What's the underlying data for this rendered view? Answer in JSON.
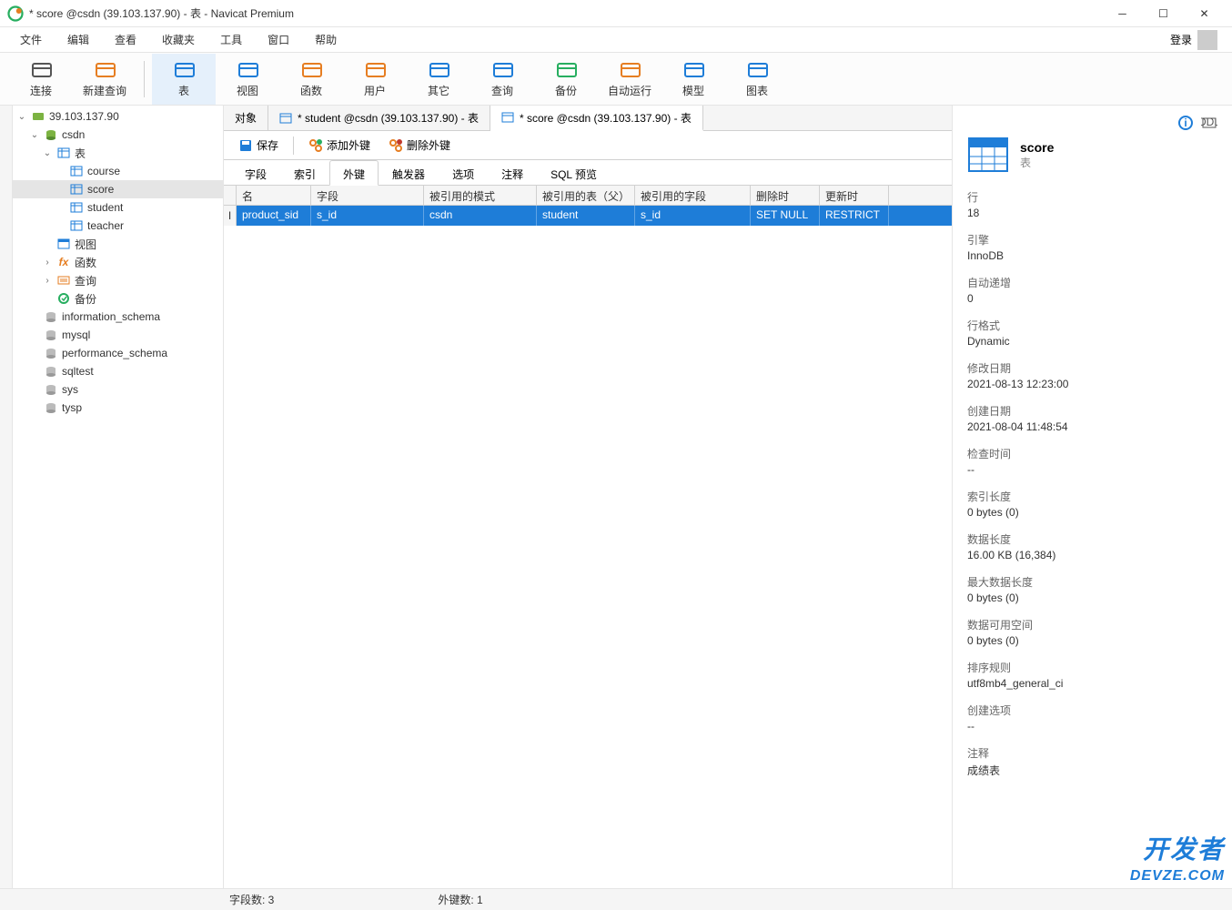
{
  "window": {
    "title": "* score @csdn (39.103.137.90) - 表 - Navicat Premium",
    "login": "登录"
  },
  "menubar": [
    "文件",
    "编辑",
    "查看",
    "收藏夹",
    "工具",
    "窗口",
    "帮助"
  ],
  "toolbar": [
    {
      "label": "连接",
      "color": "#555"
    },
    {
      "label": "新建查询",
      "color": "#e67e22"
    },
    {
      "label": "表",
      "color": "#1e7dd8",
      "active": true
    },
    {
      "label": "视图",
      "color": "#1e7dd8"
    },
    {
      "label": "函数",
      "color": "#e67e22"
    },
    {
      "label": "用户",
      "color": "#e67e22"
    },
    {
      "label": "其它",
      "color": "#1e7dd8"
    },
    {
      "label": "查询",
      "color": "#1e7dd8"
    },
    {
      "label": "备份",
      "color": "#27ae60"
    },
    {
      "label": "自动运行",
      "color": "#e67e22"
    },
    {
      "label": "模型",
      "color": "#1e7dd8"
    },
    {
      "label": "图表",
      "color": "#1e7dd8"
    }
  ],
  "tree": {
    "server": "39.103.137.90",
    "db_csdn": "csdn",
    "group_table": "表",
    "tables": [
      "course",
      "score",
      "student",
      "teacher"
    ],
    "view": "视图",
    "func": "函数",
    "query": "查询",
    "backup": "备份",
    "other_dbs": [
      "information_schema",
      "mysql",
      "performance_schema",
      "sqltest",
      "sys",
      "tysp"
    ]
  },
  "tabs": {
    "t0": "对象",
    "t1": "* student @csdn (39.103.137.90) - 表",
    "t2": "* score @csdn (39.103.137.90) - 表"
  },
  "actions": {
    "save": "保存",
    "add_fk": "添加外键",
    "del_fk": "删除外键"
  },
  "subtabs": [
    "字段",
    "索引",
    "外键",
    "触发器",
    "选项",
    "注释",
    "SQL 预览"
  ],
  "grid": {
    "headers": {
      "name": "名",
      "field": "字段",
      "schema": "被引用的模式",
      "ptable": "被引用的表（父）",
      "pfield": "被引用的字段",
      "del": "删除时",
      "upd": "更新时"
    },
    "row": {
      "name": "product_sid",
      "field": "s_id",
      "schema": "csdn",
      "ptable": "student",
      "pfield": "s_id",
      "del": "SET NULL",
      "upd": "RESTRICT"
    }
  },
  "props": {
    "title": "score",
    "sub": "表",
    "rows_l": "行",
    "rows_v": "18",
    "engine_l": "引擎",
    "engine_v": "InnoDB",
    "ai_l": "自动递增",
    "ai_v": "0",
    "rf_l": "行格式",
    "rf_v": "Dynamic",
    "mdate_l": "修改日期",
    "mdate_v": "2021-08-13 12:23:00",
    "cdate_l": "创建日期",
    "cdate_v": "2021-08-04 11:48:54",
    "chk_l": "检查时间",
    "chk_v": "--",
    "idx_l": "索引长度",
    "idx_v": "0 bytes (0)",
    "dlen_l": "数据长度",
    "dlen_v": "16.00 KB (16,384)",
    "mlen_l": "最大数据长度",
    "mlen_v": "0 bytes (0)",
    "free_l": "数据可用空间",
    "free_v": "0 bytes (0)",
    "coll_l": "排序规则",
    "coll_v": "utf8mb4_general_ci",
    "copt_l": "创建选项",
    "copt_v": "--",
    "cmt_l": "注释",
    "cmt_v": "成绩表"
  },
  "status": {
    "fields": "字段数: 3",
    "fks": "外键数: 1"
  },
  "watermark": {
    "cn": "开发者",
    "url": "DEVZE.COM"
  }
}
